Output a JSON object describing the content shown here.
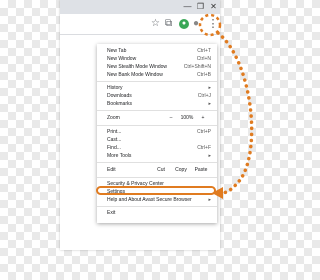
{
  "window": {
    "minimize_icon": "minimize-icon",
    "maximize_icon": "maximize-icon",
    "close_icon": "close-icon"
  },
  "toolbar": {
    "icons": [
      "star-icon",
      "extension-icon",
      "extension-green-icon",
      "profile-icon"
    ]
  },
  "menu": {
    "group1": [
      {
        "label": "New Tab",
        "shortcut": "Ctrl+T"
      },
      {
        "label": "New Window",
        "shortcut": "Ctrl+N"
      },
      {
        "label": "New Stealth Mode Window",
        "shortcut": "Ctrl+Shift+N"
      },
      {
        "label": "New Bank Mode Window",
        "shortcut": "Ctrl+B"
      }
    ],
    "group2": [
      {
        "label": "History",
        "shortcut": "▸"
      },
      {
        "label": "Downloads",
        "shortcut": "Ctrl+J"
      },
      {
        "label": "Bookmarks",
        "shortcut": "▸"
      }
    ],
    "zoom": {
      "label": "Zoom",
      "minus": "–",
      "value": "100%",
      "plus": "+"
    },
    "group3": [
      {
        "label": "Print...",
        "shortcut": "Ctrl+P"
      },
      {
        "label": "Cast...",
        "shortcut": ""
      },
      {
        "label": "Find...",
        "shortcut": "Ctrl+F"
      },
      {
        "label": "More Tools",
        "shortcut": "▸"
      }
    ],
    "edit": {
      "label": "Edit",
      "cut": "Cut",
      "copy": "Copy",
      "paste": "Paste"
    },
    "group4": [
      {
        "label": "Security & Privacy Center",
        "shortcut": ""
      },
      {
        "label": "Settings",
        "shortcut": ""
      },
      {
        "label": "Help and About Avast Secure Browser",
        "shortcut": "▸"
      }
    ],
    "exit": {
      "label": "Exit"
    }
  },
  "colors": {
    "accent": "#e07b20",
    "highlight_border": "#e07b20"
  }
}
